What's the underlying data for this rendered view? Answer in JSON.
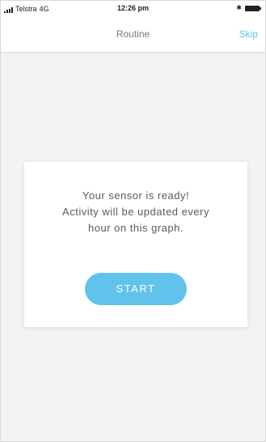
{
  "status_bar": {
    "carrier": "Telstra",
    "network": "4G",
    "time": "12:26 pm",
    "bluetooth_icon": "bluetooth-icon",
    "battery_icon": "battery-icon"
  },
  "nav": {
    "title": "Routine",
    "skip_label": "Skip"
  },
  "card": {
    "message_lines": [
      "Your sensor is ready!",
      "Activity will be updated every",
      "hour on this graph."
    ],
    "start_label": "START"
  },
  "colors": {
    "accent": "#61c3ec",
    "background": "#f3f3f3",
    "card": "#ffffff",
    "text": "#5b5b5b"
  }
}
